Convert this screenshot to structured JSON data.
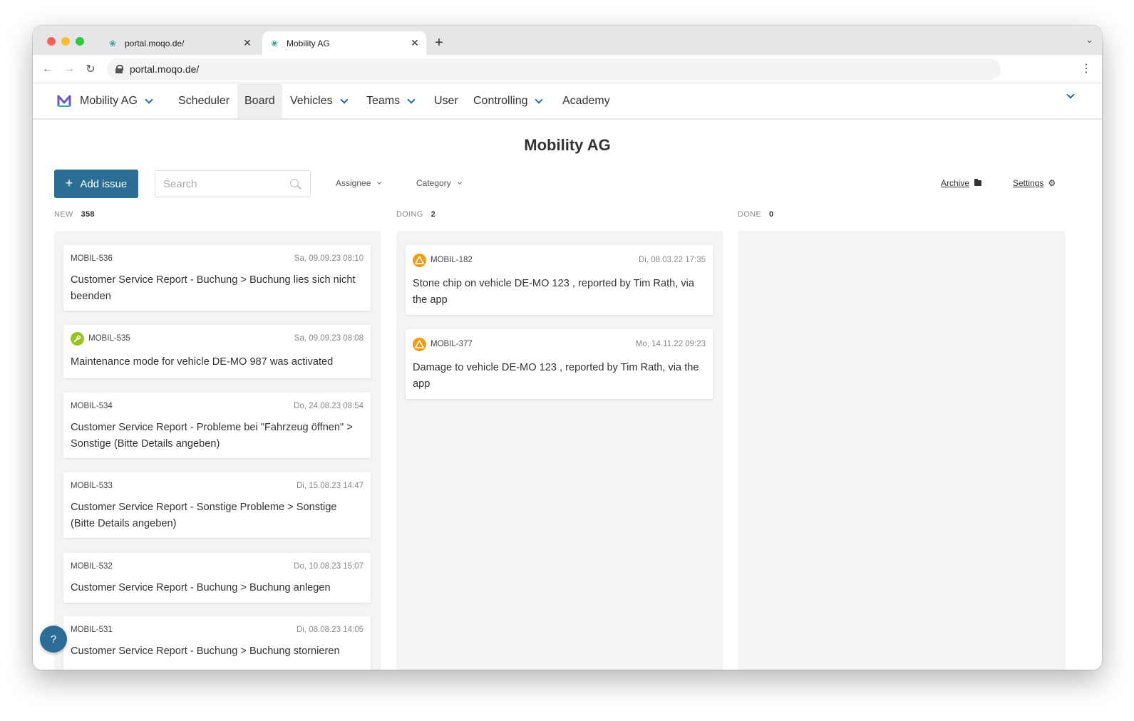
{
  "browser": {
    "tabs": [
      {
        "title": "portal.moqo.de/",
        "active": false
      },
      {
        "title": "Mobility AG",
        "active": true
      }
    ],
    "new_tab": "+",
    "close": "✕",
    "url": "portal.moqo.de/"
  },
  "nav": {
    "brand": "Mobility AG",
    "items": [
      {
        "label": "Scheduler",
        "dropdown": false,
        "active": false
      },
      {
        "label": "Board",
        "dropdown": false,
        "active": true
      },
      {
        "label": "Vehicles",
        "dropdown": true,
        "active": false
      },
      {
        "label": "Teams",
        "dropdown": true,
        "active": false
      },
      {
        "label": "User",
        "dropdown": false,
        "active": false
      },
      {
        "label": "Controlling",
        "dropdown": true,
        "active": false
      },
      {
        "label": "Academy",
        "dropdown": false,
        "active": false
      }
    ]
  },
  "page": {
    "title": "Mobility AG"
  },
  "toolbar": {
    "add_issue": "Add issue",
    "search_placeholder": "Search",
    "assignee": "Assignee",
    "category": "Category",
    "archive": "Archive",
    "settings": "Settings"
  },
  "columns": [
    {
      "name": "NEW",
      "count": "358",
      "cards": [
        {
          "id": "MOBIL-536",
          "date": "Sa, 09.09.23 08:10",
          "icon": "",
          "text": "Customer Service Report - Buchung > Buchung lies sich nicht beenden"
        },
        {
          "id": "MOBIL-535",
          "date": "Sa, 09.09.23 08:08",
          "icon": "wrench-icon",
          "text": "Maintenance mode for vehicle DE-MO 987 was activated"
        },
        {
          "id": "MOBIL-534",
          "date": "Do, 24.08.23 08:54",
          "icon": "",
          "text": "Customer Service Report - Probleme bei \"Fahrzeug öffnen\" > Sonstige (Bitte Details angeben)"
        },
        {
          "id": "MOBIL-533",
          "date": "Di, 15.08.23 14:47",
          "icon": "",
          "text": "Customer Service Report - Sonstige Probleme > Sonstige (Bitte Details angeben)"
        },
        {
          "id": "MOBIL-532",
          "date": "Do, 10.08.23 15:07",
          "icon": "",
          "text": "Customer Service Report - Buchung > Buchung anlegen"
        },
        {
          "id": "MOBIL-531",
          "date": "Di, 08.08.23 14:05",
          "icon": "",
          "text": "Customer Service Report - Buchung > Buchung stornieren"
        }
      ]
    },
    {
      "name": "DOING",
      "count": "2",
      "cards": [
        {
          "id": "MOBIL-182",
          "date": "Di, 08.03.22 17:35",
          "icon": "warning-icon",
          "text": "Stone chip on vehicle DE-MO 123 , reported by Tim Rath, via the app"
        },
        {
          "id": "MOBIL-377",
          "date": "Mo, 14.11.22 09:23",
          "icon": "warning-icon",
          "text": "Damage to vehicle DE-MO 123 , reported by Tim Rath, via the app"
        }
      ]
    },
    {
      "name": "DONE",
      "count": "0",
      "cards": []
    }
  ],
  "help": "?",
  "colors": {
    "primary": "#2a6e96",
    "warning": "#f39c12",
    "maintenance": "#9bc21f",
    "column_bg": "#f4f4f4"
  }
}
